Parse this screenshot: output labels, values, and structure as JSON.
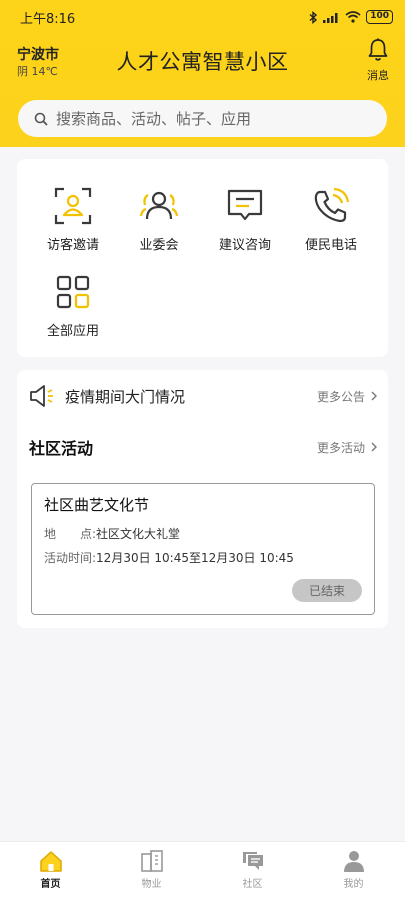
{
  "status_bar": {
    "time": "上午8:16",
    "battery": "100"
  },
  "header": {
    "city": "宁波市",
    "weather": "阴 14℃",
    "title": "人才公寓智慧小区",
    "message_label": "消息"
  },
  "search": {
    "placeholder": "搜索商品、活动、帖子、应用"
  },
  "apps": [
    {
      "label": "访客邀请",
      "icon": "visitor-invite-icon"
    },
    {
      "label": "业委会",
      "icon": "committee-icon"
    },
    {
      "label": "建议咨询",
      "icon": "suggestion-icon"
    },
    {
      "label": "便民电话",
      "icon": "phone-icon"
    },
    {
      "label": "全部应用",
      "icon": "all-apps-icon"
    }
  ],
  "notice": {
    "text": "疫情期间大门情况",
    "more": "更多公告"
  },
  "activities": {
    "title": "社区活动",
    "more": "更多活动",
    "event": {
      "title": "社区曲艺文化节",
      "location_label": "地　　点:",
      "location": "社区文化大礼堂",
      "time_label": "活动时间:",
      "time": "12月30日 10:45至12月30日 10:45",
      "status": "已结束"
    }
  },
  "tabs": [
    {
      "label": "首页",
      "active": true
    },
    {
      "label": "物业",
      "active": false
    },
    {
      "label": "社区",
      "active": false
    },
    {
      "label": "我的",
      "active": false
    }
  ],
  "colors": {
    "accent": "#fdd21c",
    "icon_dark": "#3a3a3a"
  }
}
